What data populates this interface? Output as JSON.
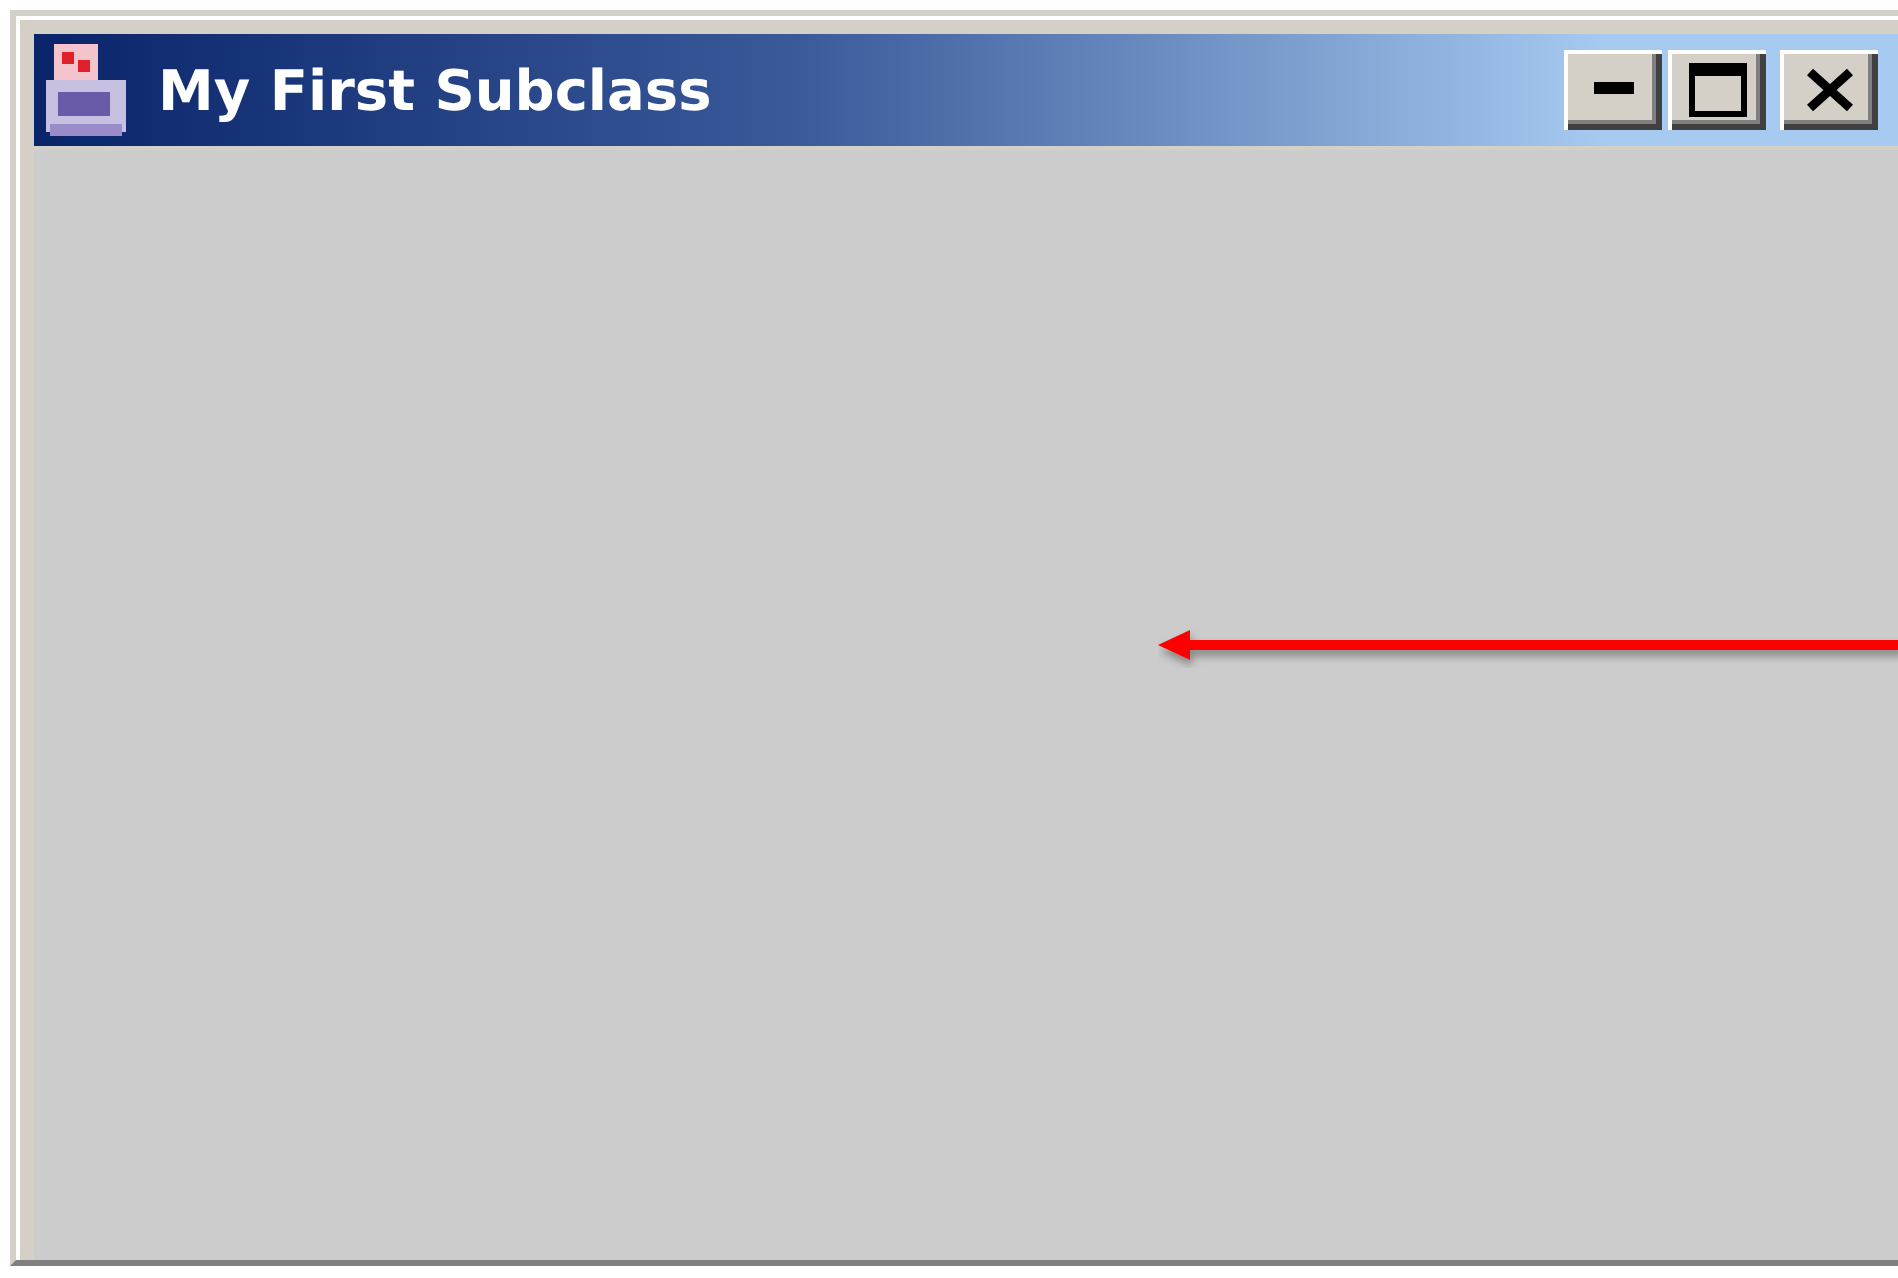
{
  "window": {
    "title": "My First Subclass"
  }
}
